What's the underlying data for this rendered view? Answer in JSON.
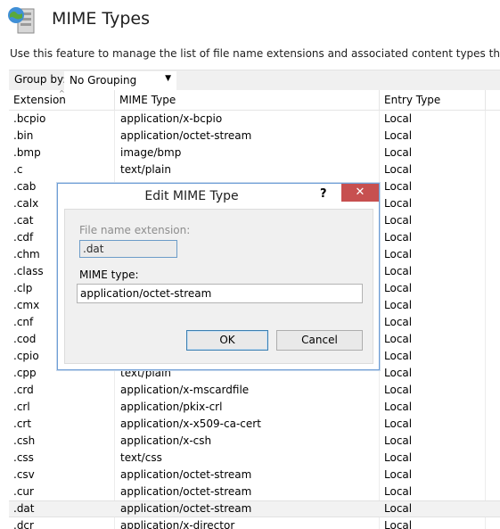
{
  "header": {
    "title": "MIME Types",
    "icon": "mime-types-icon"
  },
  "description": "Use this feature to manage the list of file name extensions and associated content types that are served as",
  "toolbar": {
    "group_by_label": "Group by:",
    "group_by_value": "No Grouping"
  },
  "grid": {
    "columns": [
      "Extension",
      "MIME Type",
      "Entry Type"
    ],
    "rows": [
      [
        ".bcpio",
        "application/x-bcpio",
        "Local"
      ],
      [
        ".bin",
        "application/octet-stream",
        "Local"
      ],
      [
        ".bmp",
        "image/bmp",
        "Local"
      ],
      [
        ".c",
        "text/plain",
        "Local"
      ],
      [
        ".cab",
        "",
        "Local"
      ],
      [
        ".calx",
        "",
        "Local"
      ],
      [
        ".cat",
        "",
        "Local"
      ],
      [
        ".cdf",
        "",
        "Local"
      ],
      [
        ".chm",
        "",
        "Local"
      ],
      [
        ".class",
        "",
        "Local"
      ],
      [
        ".clp",
        "",
        "Local"
      ],
      [
        ".cmx",
        "",
        "Local"
      ],
      [
        ".cnf",
        "",
        "Local"
      ],
      [
        ".cod",
        "",
        "Local"
      ],
      [
        ".cpio",
        "",
        "Local"
      ],
      [
        ".cpp",
        "text/plain",
        "Local"
      ],
      [
        ".crd",
        "application/x-mscardfile",
        "Local"
      ],
      [
        ".crl",
        "application/pkix-crl",
        "Local"
      ],
      [
        ".crt",
        "application/x-x509-ca-cert",
        "Local"
      ],
      [
        ".csh",
        "application/x-csh",
        "Local"
      ],
      [
        ".css",
        "text/css",
        "Local"
      ],
      [
        ".csv",
        "application/octet-stream",
        "Local"
      ],
      [
        ".cur",
        "application/octet-stream",
        "Local"
      ],
      [
        ".dat",
        "application/octet-stream",
        "Local"
      ],
      [
        ".dcr",
        "application/x-director",
        "Local"
      ]
    ],
    "selected_index": 23
  },
  "dialog": {
    "title": "Edit MIME Type",
    "help": "?",
    "close": "✕",
    "ext_label": "File name extension:",
    "ext_value": ".dat",
    "mime_label": "MIME type:",
    "mime_value": "application/octet-stream",
    "ok": "OK",
    "cancel": "Cancel"
  }
}
